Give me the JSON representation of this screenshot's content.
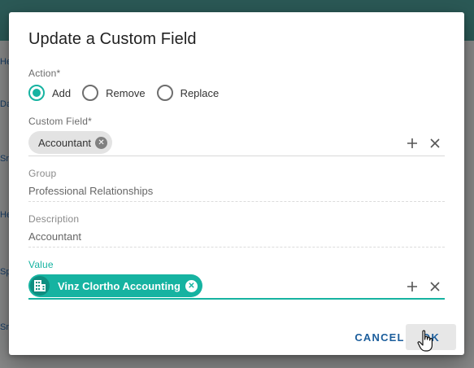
{
  "background": {
    "row_stubs": [
      "He",
      "Da",
      "Sm",
      "He",
      "Sp",
      "Sm"
    ]
  },
  "dialog": {
    "title": "Update a Custom Field",
    "action": {
      "label": "Action*",
      "options": [
        {
          "label": "Add",
          "checked": true
        },
        {
          "label": "Remove",
          "checked": false
        },
        {
          "label": "Replace",
          "checked": false
        }
      ]
    },
    "custom_field": {
      "label": "Custom Field*",
      "chip": "Accountant"
    },
    "group": {
      "label": "Group",
      "value": "Professional Relationships"
    },
    "description": {
      "label": "Description",
      "value": "Accountant"
    },
    "value_field": {
      "label": "Value",
      "chip": "Vinz Clortho Accounting"
    },
    "buttons": {
      "cancel": "CANCEL",
      "ok": "OK"
    }
  },
  "colors": {
    "accent": "#16b3a1",
    "button_text": "#1c5e9c"
  },
  "icons": {
    "add": "plus-icon",
    "clear": "close-icon",
    "chip_remove": "chip-close-icon",
    "org": "building-icon",
    "cursor": "hand-pointer-icon"
  }
}
